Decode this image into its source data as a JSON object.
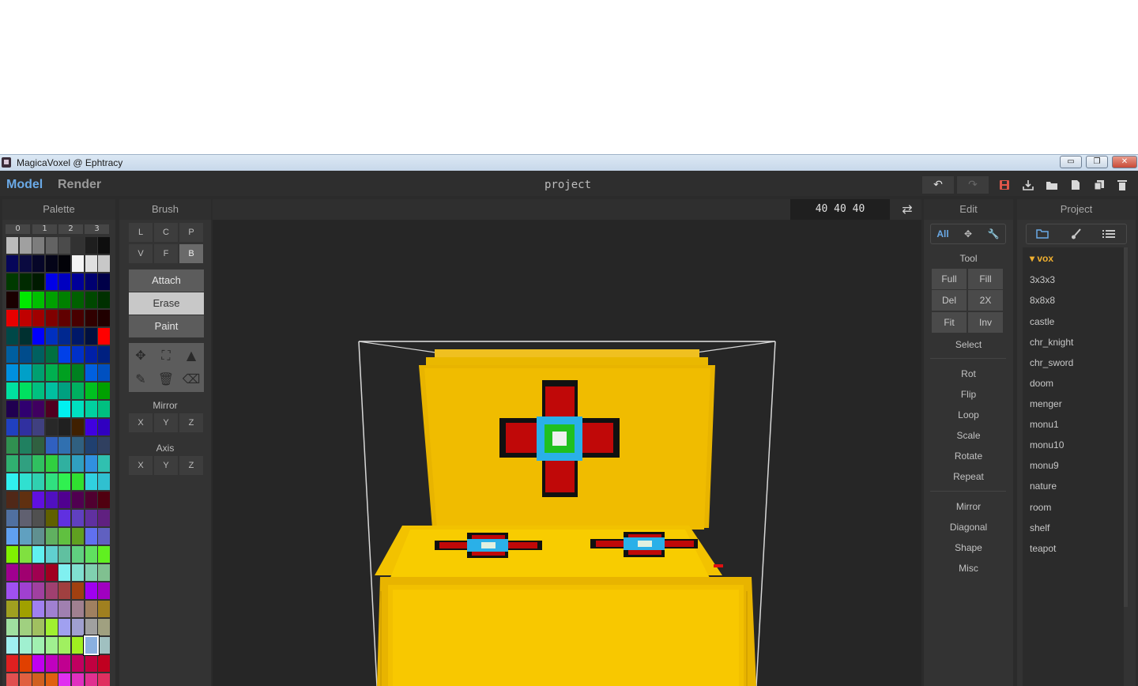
{
  "window": {
    "title": "MagicaVoxel @ Ephtracy",
    "controls": [
      "▭",
      "❐",
      "✕"
    ]
  },
  "menubar": {
    "tabs": [
      "Model",
      "Render"
    ],
    "project_title": "project"
  },
  "toolbar": {
    "undo": "↶",
    "redo": "↷"
  },
  "palette": {
    "title": "Palette",
    "pages": [
      "0",
      "1",
      "2",
      "3"
    ],
    "rows": [
      [
        "#bcbcbc",
        "#a0a0a0",
        "#7d7d7d",
        "#636363",
        "#4b4b4b",
        "#323232",
        "#1e1e1e",
        "#0e0e0e"
      ],
      [
        "#06065a",
        "#0a0a40",
        "#060628",
        "#040418",
        "#020208",
        "#f4f4f4",
        "#e0e0e0",
        "#c8c8c8"
      ],
      [
        "#003a00",
        "#002a00",
        "#001a00",
        "#0000e8",
        "#0000c0",
        "#000098",
        "#000070",
        "#000048"
      ],
      [
        "#1a0000",
        "#00e800",
        "#00c000",
        "#00a000",
        "#008000",
        "#006000",
        "#004800",
        "#003000"
      ],
      [
        "#e80000",
        "#c00000",
        "#a00000",
        "#800000",
        "#600000",
        "#480000",
        "#300000",
        "#200000"
      ],
      [
        "#004848",
        "#003030",
        "#0000ff",
        "#0030c0",
        "#002890",
        "#001868",
        "#001040",
        "#ff0000"
      ],
      [
        "#005fa0",
        "#004c8c",
        "#006060",
        "#007040",
        "#0040e8",
        "#0030c8",
        "#0020a8",
        "#002080"
      ],
      [
        "#0090e0",
        "#00a0c8",
        "#00a070",
        "#00b050",
        "#00a020",
        "#008020",
        "#0060e0",
        "#0050c0"
      ],
      [
        "#00e0a0",
        "#00e060",
        "#00c080",
        "#00c0a0",
        "#00a080",
        "#00b060",
        "#00c020",
        "#00a000"
      ],
      [
        "#200050",
        "#300070",
        "#400060",
        "#500020",
        "#00f0f0",
        "#00e0c0",
        "#00d0a0",
        "#00c080"
      ],
      [
        "#2040c0",
        "#3030a0",
        "#404080",
        "#282828",
        "#202020",
        "#402000",
        "#4000e0",
        "#3000c0"
      ],
      [
        "#309050",
        "#208060",
        "#306040",
        "#3060c0",
        "#3070b0",
        "#306080",
        "#204070",
        "#304060"
      ],
      [
        "#30b070",
        "#30a080",
        "#30c060",
        "#30d040",
        "#30b0a0",
        "#30a0c0",
        "#3090e0",
        "#30c0b0"
      ],
      [
        "#30f0f0",
        "#30e0d0",
        "#30d0b0",
        "#30e080",
        "#30f050",
        "#30e030",
        "#30d0e0",
        "#30c0d0"
      ],
      [
        "#502818",
        "#603010",
        "#6010e0",
        "#5010c0",
        "#500090",
        "#500050",
        "#500030",
        "#500010"
      ],
      [
        "#5070a0",
        "#606070",
        "#505050",
        "#606000",
        "#6030e0",
        "#6040c0",
        "#6030a0",
        "#602080"
      ],
      [
        "#60a0f0",
        "#60a0c0",
        "#609090",
        "#60b060",
        "#60c040",
        "#60a020",
        "#6070f0",
        "#6060c0"
      ],
      [
        "#80f000",
        "#80e040",
        "#60f0f0",
        "#60d0d0",
        "#60c0a0",
        "#60d080",
        "#60e060",
        "#60f020"
      ],
      [
        "#a00090",
        "#a00070",
        "#a00050",
        "#a00020",
        "#80f0f0",
        "#80e0d0",
        "#80d0b0",
        "#80c090"
      ],
      [
        "#a050f0",
        "#a040d0",
        "#a040a0",
        "#a04070",
        "#a04040",
        "#a04010",
        "#a000f0",
        "#a000c0"
      ],
      [
        "#a0a020",
        "#a0a000",
        "#a080f0",
        "#a080d0",
        "#a080b0",
        "#a08090",
        "#a08060",
        "#a08020"
      ],
      [
        "#a0e0a0",
        "#a0d080",
        "#a0c060",
        "#a0f030",
        "#a0a0f0",
        "#a0a0d0",
        "#a0a0a0",
        "#a0a080"
      ],
      [
        "#a0f0f0",
        "#a0f0d0",
        "#a0f0b0",
        "#a0f090",
        "#a0f060",
        "#a0f020",
        "#a0c0f0",
        "#a0c0c0"
      ],
      [
        "#e02020",
        "#e04000",
        "#c000f0",
        "#c000c0",
        "#c00090",
        "#c00060",
        "#c00040",
        "#c00020"
      ],
      [
        "#e05050",
        "#e06040",
        "#d06020",
        "#e06010",
        "#e030f0",
        "#e030c0",
        "#e03090",
        "#e03060"
      ]
    ]
  },
  "brush": {
    "title": "Brush",
    "modes": [
      "L",
      "C",
      "P",
      "V",
      "F",
      "B"
    ],
    "actions": [
      "Attach",
      "Erase",
      "Paint"
    ],
    "mirror_label": "Mirror",
    "axis_label": "Axis",
    "axes": [
      "X",
      "Y",
      "Z"
    ],
    "tool_icons": [
      "✥",
      "⛶",
      "▲",
      "✎",
      "🗑",
      "⌫"
    ]
  },
  "viewport": {
    "dimensions": "40  40  40",
    "swap_icon": "⇄"
  },
  "edit": {
    "title": "Edit",
    "scope": [
      "All",
      "✥",
      "🔧"
    ],
    "tool_label": "Tool",
    "tools": [
      "Full",
      "Fill",
      "Del",
      "2X",
      "Fit",
      "Inv"
    ],
    "select_label": "Select",
    "transforms": [
      "Rot",
      "Flip",
      "Loop",
      "Scale",
      "Rotate",
      "Repeat"
    ],
    "more": [
      "Mirror",
      "Diagonal",
      "Shape",
      "Misc"
    ]
  },
  "project": {
    "title": "Project",
    "folder": "▾ vox",
    "files": [
      "3x3x3",
      "8x8x8",
      "castle",
      "chr_knight",
      "chr_sword",
      "doom",
      "menger",
      "monu1",
      "monu10",
      "monu9",
      "nature",
      "room",
      "shelf",
      "teapot"
    ]
  }
}
